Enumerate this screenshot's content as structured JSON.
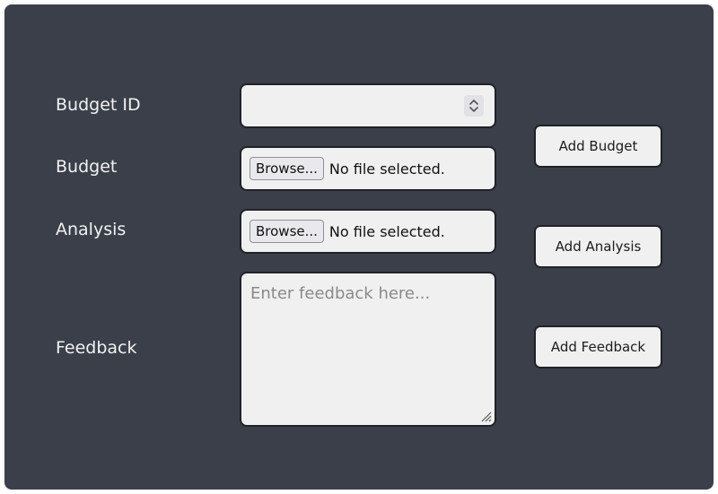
{
  "form": {
    "budget_id": {
      "label": "Budget ID",
      "value": ""
    },
    "budget": {
      "label": "Budget",
      "browse_label": "Browse...",
      "status": "No file selected."
    },
    "analysis": {
      "label": "Analysis",
      "browse_label": "Browse...",
      "status": "No file selected."
    },
    "feedback": {
      "label": "Feedback",
      "placeholder": "Enter feedback here..."
    }
  },
  "buttons": {
    "add_budget": "Add Budget",
    "add_analysis": "Add Analysis",
    "add_feedback": "Add Feedback"
  },
  "colors": {
    "background": "#3b3f4a",
    "field": "#f0f0f0",
    "label_text": "#f1f1f1"
  }
}
